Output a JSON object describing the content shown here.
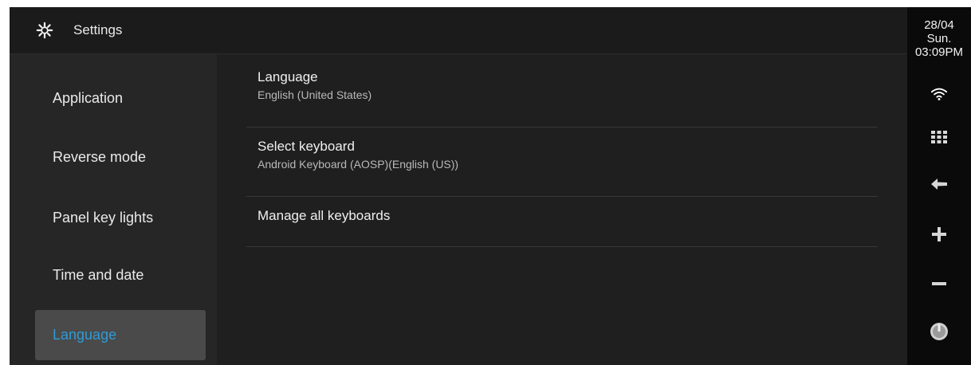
{
  "header": {
    "title": "Settings",
    "icon": "gear-icon"
  },
  "sidebar": {
    "items": [
      {
        "label": "Application",
        "active": false
      },
      {
        "label": "Reverse mode",
        "active": false
      },
      {
        "label": "Panel key lights",
        "active": false
      },
      {
        "label": "Time and date",
        "active": false
      },
      {
        "label": "Language",
        "active": true
      }
    ]
  },
  "content": {
    "rows": [
      {
        "title": "Language",
        "subtitle": "English (United States)"
      },
      {
        "title": "Select keyboard",
        "subtitle": "Android Keyboard (AOSP)(English (US))"
      },
      {
        "title": "Manage all keyboards"
      }
    ]
  },
  "status": {
    "date": "28/04",
    "day": "Sun.",
    "time": "03:09PM"
  },
  "rail": {
    "buttons": [
      "wifi-icon",
      "apps-grid-icon",
      "back-arrow-icon",
      "volume-up-icon",
      "volume-down-icon",
      "power-knob-icon"
    ]
  },
  "colors": {
    "accent": "#2e9bd6",
    "background": "#1f1f1f",
    "sidebar": "#262626",
    "rail": "#0a0a0a"
  }
}
